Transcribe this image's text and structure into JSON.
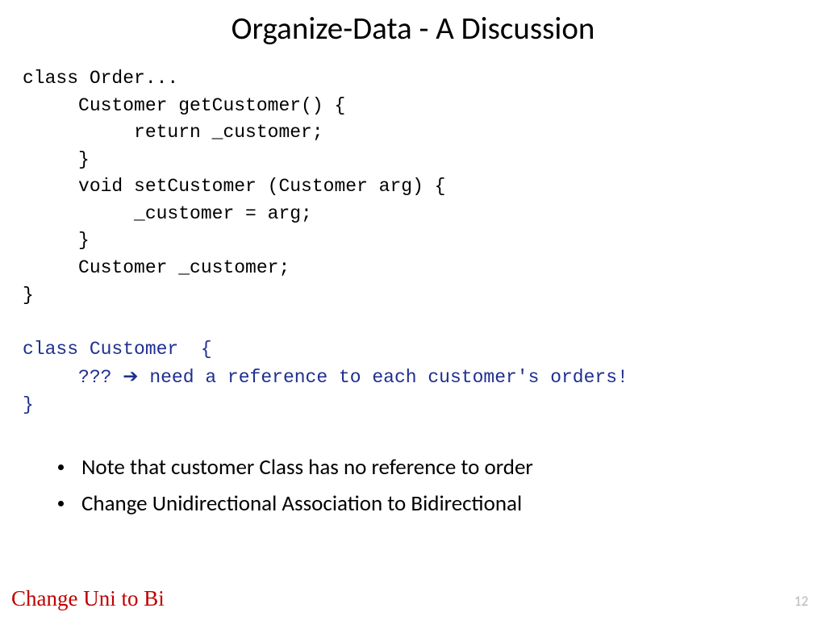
{
  "title": "Organize-Data - A Discussion",
  "code": {
    "l1": "class Order...",
    "l2": "     Customer getCustomer() {",
    "l3": "          return _customer;",
    "l4": "     }",
    "l5": "     void setCustomer (Customer arg) {",
    "l6": "          _customer = arg;",
    "l7": "     }",
    "l8": "     Customer _customer;",
    "l9": "}",
    "b1": "class Customer  {",
    "b2a": "     ??? ",
    "b2arrow": "➔",
    "b2b": " need a reference to each customer's orders!",
    "b3": "}"
  },
  "bullets": {
    "items": [
      "Note that customer Class has no reference to order",
      "Change Unidirectional Association to Bidirectional"
    ]
  },
  "footer": "Change Uni to Bi",
  "page": "12"
}
